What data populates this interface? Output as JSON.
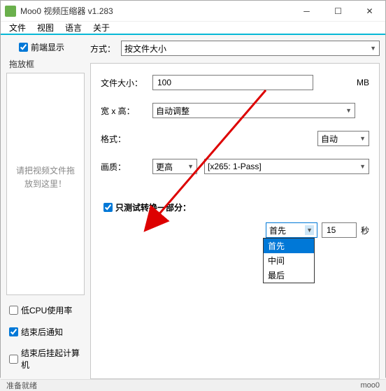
{
  "window": {
    "title": "Moo0 视频压缩器 v1.283"
  },
  "menu": {
    "file": "文件",
    "view": "视图",
    "lang": "语言",
    "about": "关于"
  },
  "left": {
    "front_display": "前端显示",
    "drop_frame_label": "拖放框",
    "drop_msg_line1": "请把视频文件拖",
    "drop_msg_line2": "放到这里！",
    "low_cpu": "低CPU使用率",
    "notify_end": "结束后通知",
    "suspend_end": "结束后挂起计算机"
  },
  "right": {
    "method_label": "方式：",
    "method_value": "按文件大小",
    "filesize_label": "文件大小：",
    "filesize_value": "100",
    "filesize_unit": "MB",
    "wh_label": "宽 x 高：",
    "wh_value": "自动调整",
    "format_label": "格式：",
    "format_value": "自动",
    "quality_label": "画质：",
    "quality_value": "更高",
    "quality_codec": "[x265: 1-Pass]",
    "test_label": "只测试转换一部分：",
    "test_dd_selected": "首先",
    "test_value": "15",
    "test_unit": "秒",
    "test_options": {
      "opt1": "首先",
      "opt2": "中间",
      "opt3": "最后"
    }
  },
  "status": {
    "ready": "准备就绪",
    "brand": "moo0"
  }
}
